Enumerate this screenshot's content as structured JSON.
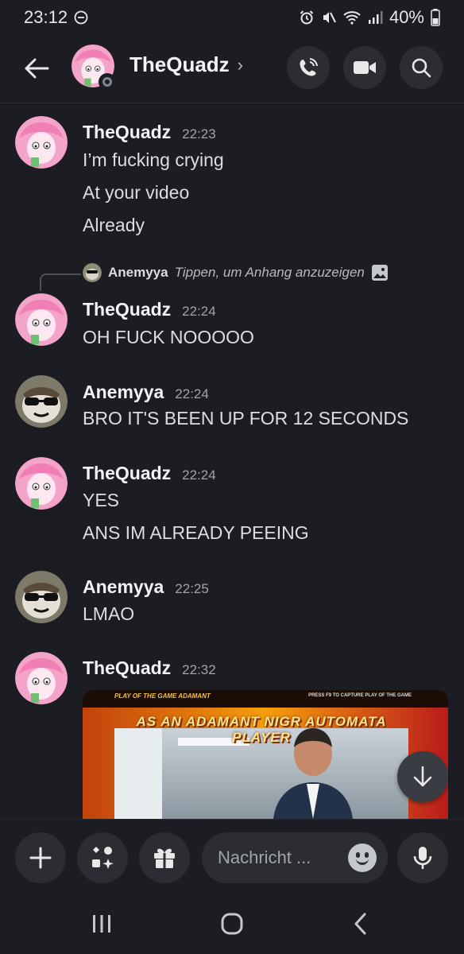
{
  "status_bar": {
    "time": "23:12",
    "battery": "40%"
  },
  "header": {
    "title": "TheQuadz",
    "chevron": "›"
  },
  "messages": [
    {
      "author": "TheQuadz",
      "time": "22:23",
      "lines": [
        "I’m fucking crying",
        "At your video",
        "Already"
      ]
    },
    {
      "author": "TheQuadz",
      "time": "22:24",
      "lines": [
        "OH FUCK NOOOOO"
      ],
      "reply": {
        "author": "Anemyya",
        "text": "Tippen, um Anhang anzuzeigen"
      }
    },
    {
      "author": "Anemyya",
      "time": "22:24",
      "lines": [
        "BRO IT'S BEEN UP FOR 12 SECONDS"
      ]
    },
    {
      "author": "TheQuadz",
      "time": "22:24",
      "lines": [
        "YES",
        "ANS IM ALREADY PEEING"
      ]
    },
    {
      "author": "Anemyya",
      "time": "22:25",
      "lines": [
        "LMAO"
      ]
    },
    {
      "author": "TheQuadz",
      "time": "22:32",
      "lines": []
    }
  ],
  "embed": {
    "top_left_text": "PLAY OF THE GAME ADAMANT",
    "top_right_text": "PRESS F9 TO CAPTURE PLAY OF THE GAME",
    "caption": "AS AN ADAMANT NIGR AUTOMATA PLAYER"
  },
  "composer": {
    "placeholder": "Nachricht ..."
  },
  "colors": {
    "background": "#1c1d22",
    "button_bg": "#2b2d33",
    "muted": "#a0a4ab"
  },
  "icons": [
    "back-arrow-icon",
    "phone-icon",
    "video-camera-icon",
    "search-icon",
    "plus-icon",
    "apps-icon",
    "gift-icon",
    "emoji-icon",
    "microphone-icon",
    "arrow-down-icon"
  ]
}
